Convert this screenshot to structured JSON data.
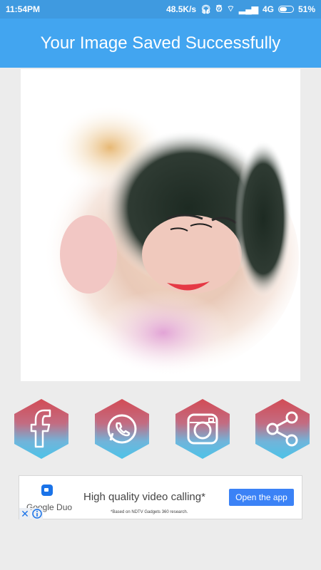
{
  "status_bar": {
    "time": "11:54PM",
    "network_speed": "48.5K/s",
    "network_type": "4G",
    "battery": "51%"
  },
  "appbar": {
    "title": "Your Image Saved Successfully"
  },
  "share_buttons": [
    {
      "name": "facebook",
      "icon": "facebook-icon"
    },
    {
      "name": "whatsapp",
      "icon": "whatsapp-icon"
    },
    {
      "name": "instagram",
      "icon": "instagram-icon"
    },
    {
      "name": "share",
      "icon": "share-icon"
    }
  ],
  "ad": {
    "brand": "Google Duo",
    "headline": "High quality video calling*",
    "disclaimer": "*Based on NDTV Gadgets 360 research.",
    "cta": "Open the app"
  },
  "colors": {
    "status_bar": "#3f9ae0",
    "app_bar": "#42a5f0",
    "hex_top": "#d24b55",
    "hex_bottom": "#4fc1e6",
    "ad_button": "#3b82f6"
  }
}
